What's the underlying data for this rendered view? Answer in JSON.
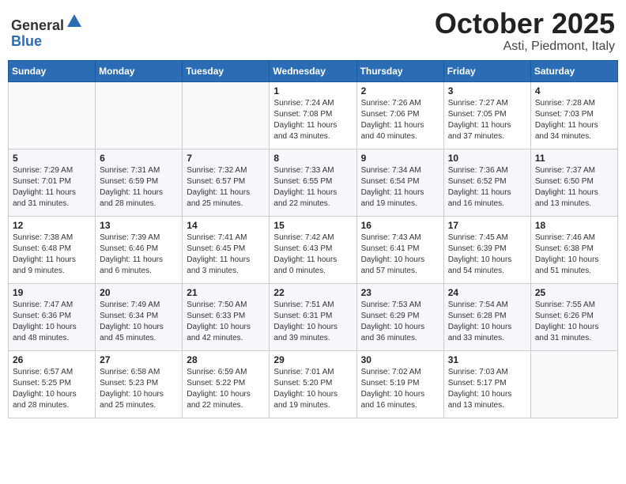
{
  "header": {
    "logo_general": "General",
    "logo_blue": "Blue",
    "month_title": "October 2025",
    "location": "Asti, Piedmont, Italy"
  },
  "days_of_week": [
    "Sunday",
    "Monday",
    "Tuesday",
    "Wednesday",
    "Thursday",
    "Friday",
    "Saturday"
  ],
  "weeks": [
    [
      {
        "day": "",
        "info": ""
      },
      {
        "day": "",
        "info": ""
      },
      {
        "day": "",
        "info": ""
      },
      {
        "day": "1",
        "info": "Sunrise: 7:24 AM\nSunset: 7:08 PM\nDaylight: 11 hours\nand 43 minutes."
      },
      {
        "day": "2",
        "info": "Sunrise: 7:26 AM\nSunset: 7:06 PM\nDaylight: 11 hours\nand 40 minutes."
      },
      {
        "day": "3",
        "info": "Sunrise: 7:27 AM\nSunset: 7:05 PM\nDaylight: 11 hours\nand 37 minutes."
      },
      {
        "day": "4",
        "info": "Sunrise: 7:28 AM\nSunset: 7:03 PM\nDaylight: 11 hours\nand 34 minutes."
      }
    ],
    [
      {
        "day": "5",
        "info": "Sunrise: 7:29 AM\nSunset: 7:01 PM\nDaylight: 11 hours\nand 31 minutes."
      },
      {
        "day": "6",
        "info": "Sunrise: 7:31 AM\nSunset: 6:59 PM\nDaylight: 11 hours\nand 28 minutes."
      },
      {
        "day": "7",
        "info": "Sunrise: 7:32 AM\nSunset: 6:57 PM\nDaylight: 11 hours\nand 25 minutes."
      },
      {
        "day": "8",
        "info": "Sunrise: 7:33 AM\nSunset: 6:55 PM\nDaylight: 11 hours\nand 22 minutes."
      },
      {
        "day": "9",
        "info": "Sunrise: 7:34 AM\nSunset: 6:54 PM\nDaylight: 11 hours\nand 19 minutes."
      },
      {
        "day": "10",
        "info": "Sunrise: 7:36 AM\nSunset: 6:52 PM\nDaylight: 11 hours\nand 16 minutes."
      },
      {
        "day": "11",
        "info": "Sunrise: 7:37 AM\nSunset: 6:50 PM\nDaylight: 11 hours\nand 13 minutes."
      }
    ],
    [
      {
        "day": "12",
        "info": "Sunrise: 7:38 AM\nSunset: 6:48 PM\nDaylight: 11 hours\nand 9 minutes."
      },
      {
        "day": "13",
        "info": "Sunrise: 7:39 AM\nSunset: 6:46 PM\nDaylight: 11 hours\nand 6 minutes."
      },
      {
        "day": "14",
        "info": "Sunrise: 7:41 AM\nSunset: 6:45 PM\nDaylight: 11 hours\nand 3 minutes."
      },
      {
        "day": "15",
        "info": "Sunrise: 7:42 AM\nSunset: 6:43 PM\nDaylight: 11 hours\nand 0 minutes."
      },
      {
        "day": "16",
        "info": "Sunrise: 7:43 AM\nSunset: 6:41 PM\nDaylight: 10 hours\nand 57 minutes."
      },
      {
        "day": "17",
        "info": "Sunrise: 7:45 AM\nSunset: 6:39 PM\nDaylight: 10 hours\nand 54 minutes."
      },
      {
        "day": "18",
        "info": "Sunrise: 7:46 AM\nSunset: 6:38 PM\nDaylight: 10 hours\nand 51 minutes."
      }
    ],
    [
      {
        "day": "19",
        "info": "Sunrise: 7:47 AM\nSunset: 6:36 PM\nDaylight: 10 hours\nand 48 minutes."
      },
      {
        "day": "20",
        "info": "Sunrise: 7:49 AM\nSunset: 6:34 PM\nDaylight: 10 hours\nand 45 minutes."
      },
      {
        "day": "21",
        "info": "Sunrise: 7:50 AM\nSunset: 6:33 PM\nDaylight: 10 hours\nand 42 minutes."
      },
      {
        "day": "22",
        "info": "Sunrise: 7:51 AM\nSunset: 6:31 PM\nDaylight: 10 hours\nand 39 minutes."
      },
      {
        "day": "23",
        "info": "Sunrise: 7:53 AM\nSunset: 6:29 PM\nDaylight: 10 hours\nand 36 minutes."
      },
      {
        "day": "24",
        "info": "Sunrise: 7:54 AM\nSunset: 6:28 PM\nDaylight: 10 hours\nand 33 minutes."
      },
      {
        "day": "25",
        "info": "Sunrise: 7:55 AM\nSunset: 6:26 PM\nDaylight: 10 hours\nand 31 minutes."
      }
    ],
    [
      {
        "day": "26",
        "info": "Sunrise: 6:57 AM\nSunset: 5:25 PM\nDaylight: 10 hours\nand 28 minutes."
      },
      {
        "day": "27",
        "info": "Sunrise: 6:58 AM\nSunset: 5:23 PM\nDaylight: 10 hours\nand 25 minutes."
      },
      {
        "day": "28",
        "info": "Sunrise: 6:59 AM\nSunset: 5:22 PM\nDaylight: 10 hours\nand 22 minutes."
      },
      {
        "day": "29",
        "info": "Sunrise: 7:01 AM\nSunset: 5:20 PM\nDaylight: 10 hours\nand 19 minutes."
      },
      {
        "day": "30",
        "info": "Sunrise: 7:02 AM\nSunset: 5:19 PM\nDaylight: 10 hours\nand 16 minutes."
      },
      {
        "day": "31",
        "info": "Sunrise: 7:03 AM\nSunset: 5:17 PM\nDaylight: 10 hours\nand 13 minutes."
      },
      {
        "day": "",
        "info": ""
      }
    ]
  ]
}
